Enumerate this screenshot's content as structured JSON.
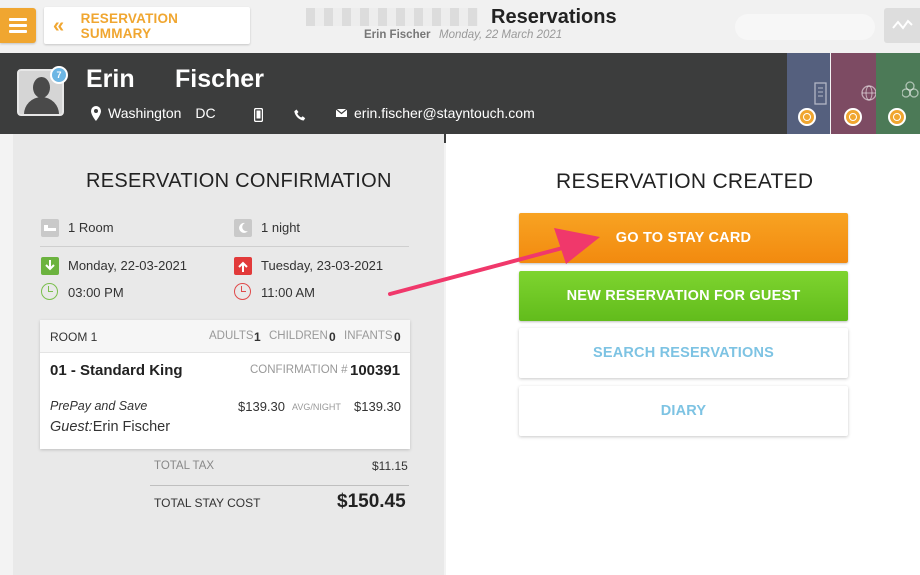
{
  "header": {
    "menu_icon": "hamburger-icon",
    "back_label": "RESERVATION SUMMARY",
    "back_icon": "double-chevron-left-icon",
    "title": "Reservations",
    "guest_name": "Erin Fischer",
    "date": "Monday, 22 March 2021",
    "activity_icon": "activity-chart-icon"
  },
  "guest": {
    "first_name": "Erin",
    "last_name": "Fischer",
    "badge_count": "7",
    "city": "Washington",
    "state": "DC",
    "email": "erin.fischer@stayntouch.com"
  },
  "side_tabs": [
    {
      "icon": "building-icon",
      "color": "#55607e"
    },
    {
      "icon": "globe-icon",
      "color": "#7d4b63"
    },
    {
      "icon": "network-icon",
      "color": "#4c7a57"
    }
  ],
  "confirmation": {
    "title": "RESERVATION CONFIRMATION",
    "rooms": "1 Room",
    "nights": "1 night",
    "arrival_date": "Monday, 22-03-2021",
    "departure_date": "Tuesday, 23-03-2021",
    "arrival_time": "03:00 PM",
    "departure_time": "11:00 AM",
    "room_card": {
      "room_label": "ROOM 1",
      "adults_label": "ADULTS",
      "adults": "1",
      "children_label": "CHILDREN",
      "children": "0",
      "infants_label": "INFANTS",
      "infants": "0",
      "room_type": "01 - Standard King",
      "confirmation_label": "CONFIRMATION #",
      "confirmation_number": "100391",
      "rate_name": "PrePay and Save",
      "avg_rate": "$139.30",
      "avg_label": "AVG/NIGHT",
      "total_rate": "$139.30",
      "guest_label": "Guest:",
      "guest_name": "Erin Fischer"
    },
    "total_tax_label": "TOTAL TAX",
    "total_tax": "$11.15",
    "total_cost_label": "TOTAL STAY COST",
    "total_cost": "$150.45"
  },
  "created": {
    "title": "RESERVATION CREATED",
    "buttons": [
      "GO TO STAY CARD",
      "NEW RESERVATION FOR GUEST",
      "SEARCH RESERVATIONS",
      "DIARY"
    ]
  },
  "colors": {
    "accent_orange": "#f0a630",
    "green": "#6cc524",
    "blue_text": "#7dc3e3",
    "annotation_arrow": "#f0386b"
  }
}
